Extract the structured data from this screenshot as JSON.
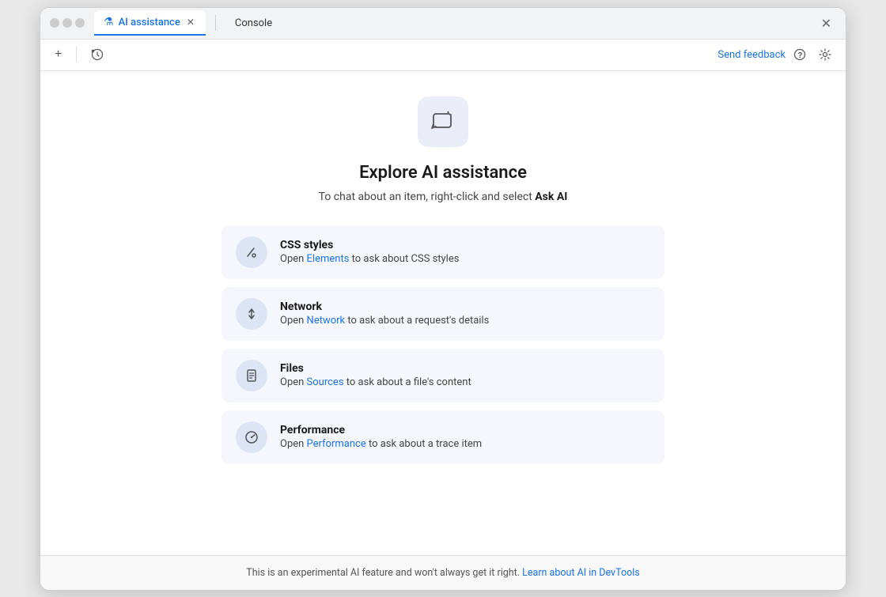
{
  "window": {
    "close_label": "✕"
  },
  "title_bar": {
    "tab_active_label": "AI assistance",
    "tab_active_icon": "⚗",
    "tab_close_icon": "✕",
    "tab_other_label": "Console",
    "dots": [
      "dot1",
      "dot2",
      "dot3"
    ]
  },
  "toolbar": {
    "new_tab_icon": "+",
    "history_icon": "↺",
    "send_feedback_label": "Send feedback",
    "help_icon": "?",
    "settings_icon": "⚙"
  },
  "hero": {
    "title": "Explore AI assistance",
    "subtitle_prefix": "To chat about an item, right-click and select ",
    "subtitle_bold": "Ask AI"
  },
  "features": [
    {
      "id": "css-styles",
      "title": "CSS styles",
      "desc_prefix": "Open ",
      "link_text": "Elements",
      "desc_suffix": " to ask about CSS styles",
      "link_href": "#"
    },
    {
      "id": "network",
      "title": "Network",
      "desc_prefix": "Open ",
      "link_text": "Network",
      "desc_suffix": " to ask about a request's details",
      "link_href": "#"
    },
    {
      "id": "files",
      "title": "Files",
      "desc_prefix": "Open ",
      "link_text": "Sources",
      "desc_suffix": " to ask about a file's content",
      "link_href": "#"
    },
    {
      "id": "performance",
      "title": "Performance",
      "desc_prefix": "Open ",
      "link_text": "Performance",
      "desc_suffix": " to ask about a trace item",
      "link_href": "#"
    }
  ],
  "footer": {
    "text_prefix": "This is an experimental AI feature and won't always get it right. ",
    "link_text": "Learn about AI in DevTools",
    "link_href": "#"
  }
}
